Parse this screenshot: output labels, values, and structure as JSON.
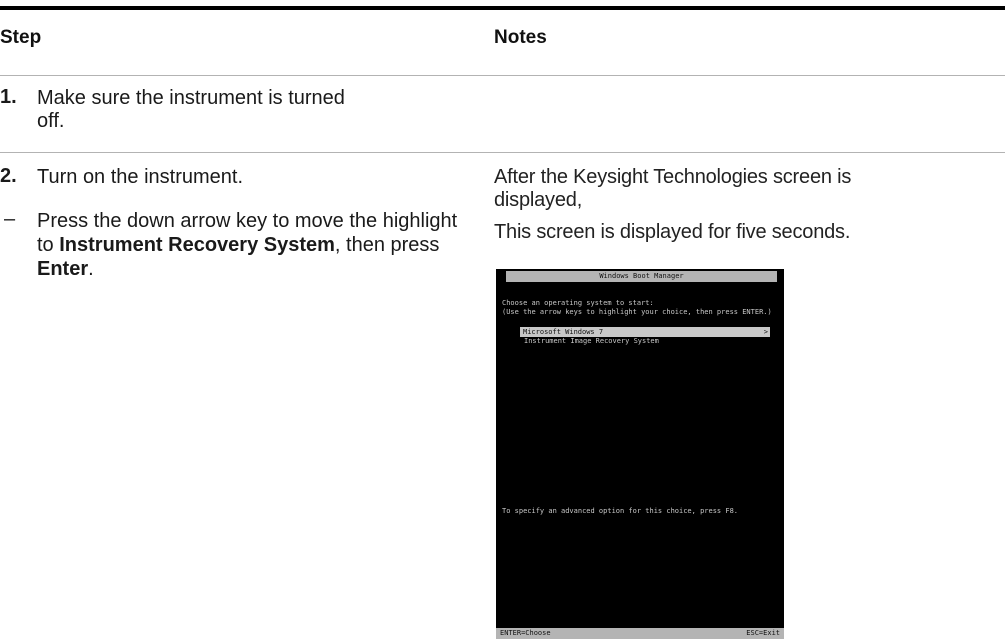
{
  "table": {
    "header_step": "Step",
    "header_notes": "Notes"
  },
  "steps": [
    {
      "number": "1.",
      "text_line1": "Make sure the instrument is turned",
      "text_line2": "off."
    },
    {
      "number": "2.",
      "text": "Turn on the instrument."
    }
  ],
  "substep": {
    "dash": "–",
    "text_pre": "Press the down arrow key to move the highlight to ",
    "bold1": "Instrument Recovery System",
    "text_mid": ", then press ",
    "bold2": "Enter",
    "text_post": "."
  },
  "notes": {
    "line1": "After the Keysight Technologies screen is",
    "line2": "displayed,",
    "line3": "This screen is displayed for five seconds."
  },
  "boot_screen": {
    "title": "Windows Boot Manager",
    "prompt1": "Choose an operating system to start:",
    "prompt2": "(Use the arrow keys to highlight your choice, then press ENTER.)",
    "option_selected": "Microsoft Windows 7",
    "option_selected_arrow": ">",
    "option_2": "Instrument Image Recovery System",
    "advanced_hint": "To specify an advanced option for this choice, press F8.",
    "footer_left": "ENTER=Choose",
    "footer_right": "ESC=Exit"
  }
}
